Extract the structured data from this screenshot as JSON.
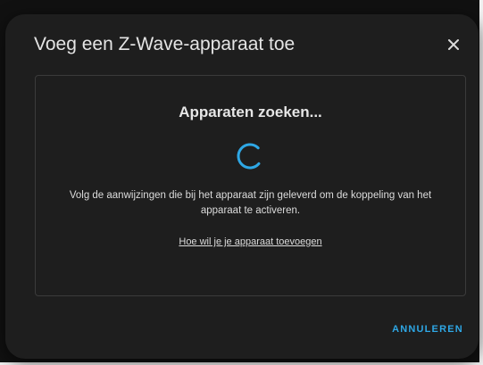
{
  "dialog": {
    "title": "Voeg een Z-Wave-apparaat toe",
    "close_icon": "close-icon",
    "searching_title": "Apparaten zoeken...",
    "spinner_icon": "loading-spinner-icon",
    "instructions": "Volg de aanwijzingen die bij het apparaat zijn geleverd om de koppeling van het apparaat te activeren.",
    "help_link": "Hoe wil je je apparaat toevoegen",
    "cancel_label": "ANNULEREN"
  },
  "colors": {
    "dialog_background": "#1e1e1e",
    "accent": "#2ea7e5",
    "text": "#e4e4e4"
  }
}
